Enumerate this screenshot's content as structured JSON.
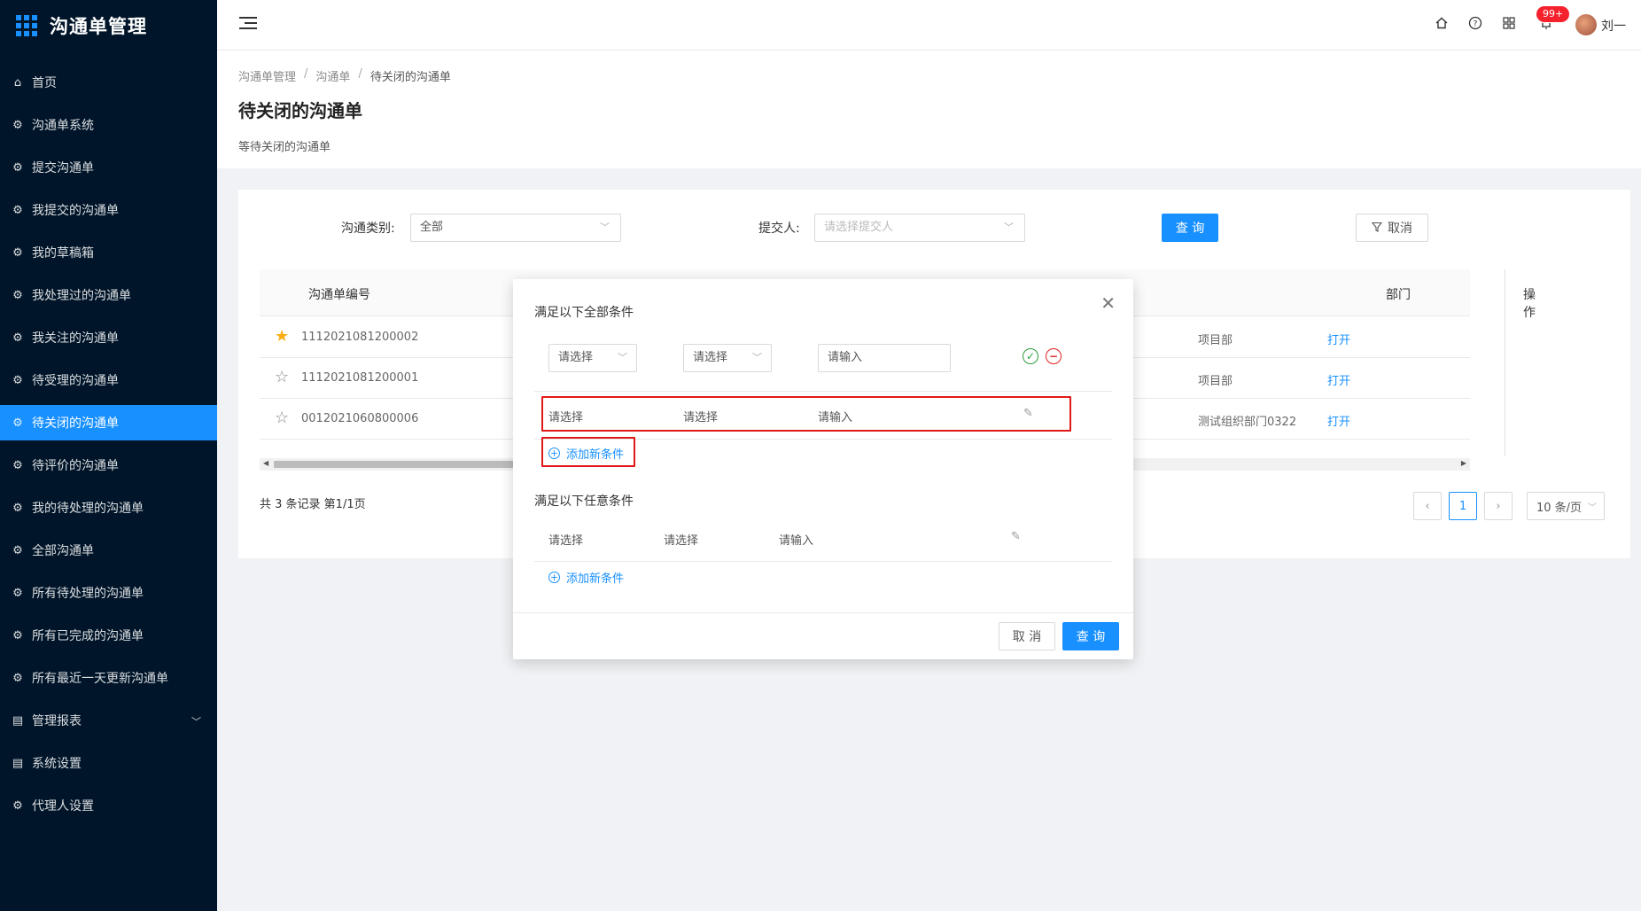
{
  "app": {
    "title": "沟通单管理"
  },
  "sidebar": {
    "items": [
      {
        "label": "首页",
        "icon": "home-icon"
      },
      {
        "label": "沟通单系统",
        "icon": "gear-icon"
      },
      {
        "label": "提交沟通单",
        "icon": "gear-icon"
      },
      {
        "label": "我提交的沟通单",
        "icon": "gear-icon"
      },
      {
        "label": "我的草稿箱",
        "icon": "gear-icon"
      },
      {
        "label": "我处理过的沟通单",
        "icon": "gear-icon"
      },
      {
        "label": "我关注的沟通单",
        "icon": "gear-icon"
      },
      {
        "label": "待受理的沟通单",
        "icon": "gear-icon"
      },
      {
        "label": "待关闭的沟通单",
        "icon": "gear-icon"
      },
      {
        "label": "待评价的沟通单",
        "icon": "gear-icon"
      },
      {
        "label": "我的待处理的沟通单",
        "icon": "gear-icon"
      },
      {
        "label": "全部沟通单",
        "icon": "gear-icon"
      },
      {
        "label": "所有待处理的沟通单",
        "icon": "gear-icon"
      },
      {
        "label": "所有已完成的沟通单",
        "icon": "gear-icon"
      },
      {
        "label": "所有最近一天更新沟通单",
        "icon": "gear-icon"
      },
      {
        "label": "管理报表",
        "icon": "report-icon"
      },
      {
        "label": "系统设置",
        "icon": "settings-list-icon"
      },
      {
        "label": "代理人设置",
        "icon": "gear-icon"
      }
    ],
    "active_index": 8
  },
  "header": {
    "badge": "99+",
    "username": "刘一"
  },
  "page": {
    "breadcrumb": [
      "沟通单管理",
      "沟通单",
      "待关闭的沟通单"
    ],
    "title": "待关闭的沟通单",
    "description": "等待关闭的沟通单"
  },
  "filters": {
    "category_label": "沟通类别:",
    "category_value": "全部",
    "submitter_label": "提交人:",
    "submitter_placeholder": "请选择提交人",
    "query_button": "查 询",
    "cancel_button": "取消"
  },
  "table": {
    "columns": {
      "number": "沟通单编号",
      "department": "部门",
      "action": "操作"
    },
    "rows": [
      {
        "starred": true,
        "number": "1112021081200002",
        "department": "项目部",
        "action": "打开"
      },
      {
        "starred": false,
        "number": "1112021081200001",
        "department": "项目部",
        "action": "打开"
      },
      {
        "starred": false,
        "number": "0012021060800006",
        "department": "测试组织部门0322",
        "action": "打开"
      }
    ]
  },
  "pagination": {
    "total_text": "共 3 条记录 第1/1页",
    "current_page": "1",
    "page_size": "10 条/页"
  },
  "modal": {
    "all_conditions_title": "满足以下全部条件",
    "any_conditions_title": "满足以下任意条件",
    "select_placeholder": "请选择",
    "input_placeholder": "请输入",
    "add_condition": "添加新条件",
    "cancel_button": "取 消",
    "query_button": "查 询"
  },
  "colors": {
    "primary": "#1890ff",
    "sidebar_bg": "#001529",
    "highlight_red": "#e01818"
  }
}
